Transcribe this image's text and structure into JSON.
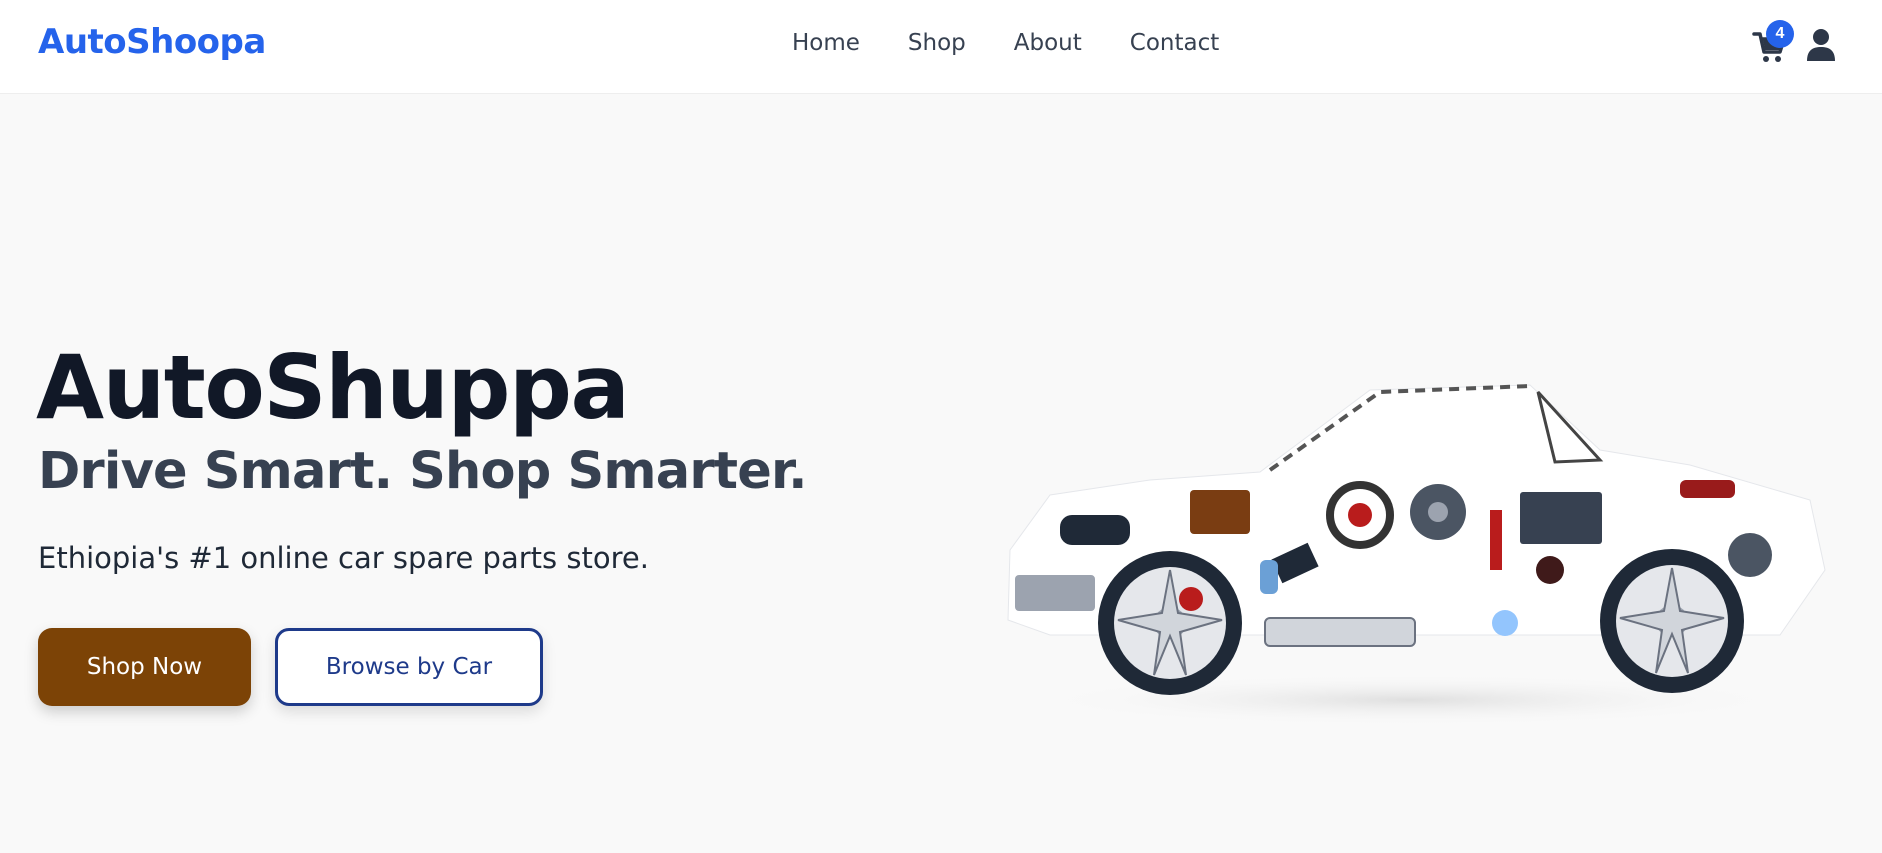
{
  "header": {
    "brand": "AutoShoopa",
    "nav": [
      "Home",
      "Shop",
      "About",
      "Contact"
    ],
    "cart_count": "4"
  },
  "hero": {
    "title": "AutoShuppa",
    "subtitle": "Drive Smart. Shop Smarter.",
    "description": "Ethiopia's #1 online car spare parts store.",
    "primary_button": "Shop Now",
    "secondary_button": "Browse by Car"
  },
  "icons": {
    "cart": "cart-icon",
    "user": "user-icon",
    "hero_image": "car-made-of-parts-image"
  },
  "colors": {
    "brand": "#2563eb",
    "primary_button": "#7c4306",
    "secondary_button_border": "#1e3a8a",
    "badge": "#2563eb"
  }
}
